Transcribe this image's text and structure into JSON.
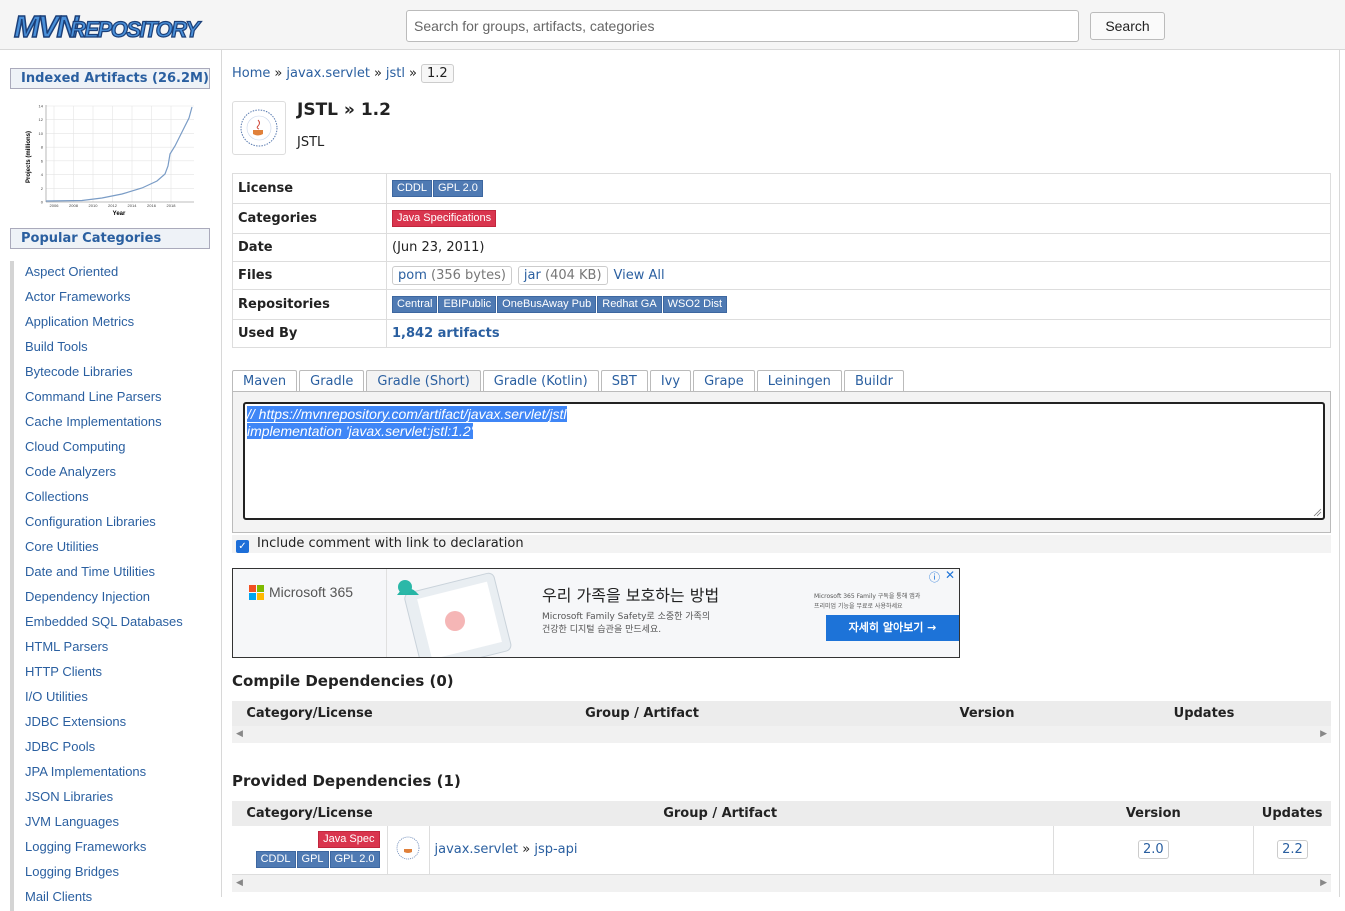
{
  "header": {
    "logo_mvn": "MVN",
    "logo_repository": "REPOSITORY",
    "search_placeholder": "Search for groups, artifacts, categories",
    "search_button": "Search"
  },
  "sidebar": {
    "indexed_title": "Indexed Artifacts (26.2M)",
    "chart": {
      "ylabel": "Projects (millions)",
      "xlabel": "Year",
      "yticks": [
        "14",
        "12",
        "10",
        "8",
        "6",
        "4",
        "2",
        "0"
      ],
      "xticks": [
        "2006",
        "2008",
        "2010",
        "2012",
        "2014",
        "2016",
        "2018"
      ]
    },
    "popular_title": "Popular Categories",
    "categories": [
      "Aspect Oriented",
      "Actor Frameworks",
      "Application Metrics",
      "Build Tools",
      "Bytecode Libraries",
      "Command Line Parsers",
      "Cache Implementations",
      "Cloud Computing",
      "Code Analyzers",
      "Collections",
      "Configuration Libraries",
      "Core Utilities",
      "Date and Time Utilities",
      "Dependency Injection",
      "Embedded SQL Databases",
      "HTML Parsers",
      "HTTP Clients",
      "I/O Utilities",
      "JDBC Extensions",
      "JDBC Pools",
      "JPA Implementations",
      "JSON Libraries",
      "JVM Languages",
      "Logging Frameworks",
      "Logging Bridges",
      "Mail Clients"
    ]
  },
  "breadcrumb": {
    "home": "Home",
    "group": "javax.servlet",
    "artifact": "jstl",
    "sep": "»",
    "version": "1.2"
  },
  "artifact": {
    "title": "JSTL » 1.2",
    "subtitle": "JSTL"
  },
  "info": {
    "license_label": "License",
    "licenses": [
      "CDDL",
      "GPL 2.0"
    ],
    "categories_label": "Categories",
    "category": "Java Specifications",
    "date_label": "Date",
    "date": "(Jun 23, 2011)",
    "files_label": "Files",
    "pom": "pom",
    "pom_size": "(356 bytes)",
    "jar": "jar",
    "jar_size": "(404 KB)",
    "view_all": "View All",
    "repositories_label": "Repositories",
    "repositories": [
      "Central",
      "EBIPublic",
      "OneBusAway Pub",
      "Redhat GA",
      "WSO2 Dist"
    ],
    "used_by_label": "Used By",
    "used_by": "1,842 artifacts"
  },
  "tabs": [
    "Maven",
    "Gradle",
    "Gradle (Short)",
    "Gradle (Kotlin)",
    "SBT",
    "Ivy",
    "Grape",
    "Leiningen",
    "Buildr"
  ],
  "active_tab": "Gradle (Short)",
  "snippet": {
    "line1": "// https://mvnrepository.com/artifact/javax.servlet/jstl",
    "line2": "implementation 'javax.servlet:jstl:1.2'"
  },
  "include_comment": "Include comment with link to declaration",
  "ad": {
    "brand": "Microsoft 365",
    "headline": "우리 가족을 보호하는 방법",
    "body1": "Microsoft Family Safety로 소중한 가족의",
    "body2": "건강한 디지털 습관을 만드세요.",
    "small1": "Microsoft 365 Family 구독을 통해 앱과",
    "small2": "프리미엄 기능을 무료로 사용하세요",
    "cta": "자세히 알아보기 →"
  },
  "compile": {
    "title": "Compile Dependencies (0)",
    "headers": [
      "Category/License",
      "Group / Artifact",
      "Version",
      "Updates"
    ]
  },
  "provided": {
    "title": "Provided Dependencies (1)",
    "headers": [
      "Category/License",
      "Group / Artifact",
      "Version",
      "Updates"
    ],
    "row": {
      "category": "Java Spec",
      "licenses": [
        "CDDL",
        "GPL",
        "GPL 2.0"
      ],
      "group": "javax.servlet",
      "sep": "»",
      "artifact": "jsp-api",
      "version": "2.0",
      "update": "2.2"
    }
  },
  "colors": {
    "link": "#2a5fa0",
    "badge": "#4f7ab3",
    "badge_red": "#d9354e",
    "selection": "#3f86f6",
    "cta": "#1d73d8"
  }
}
